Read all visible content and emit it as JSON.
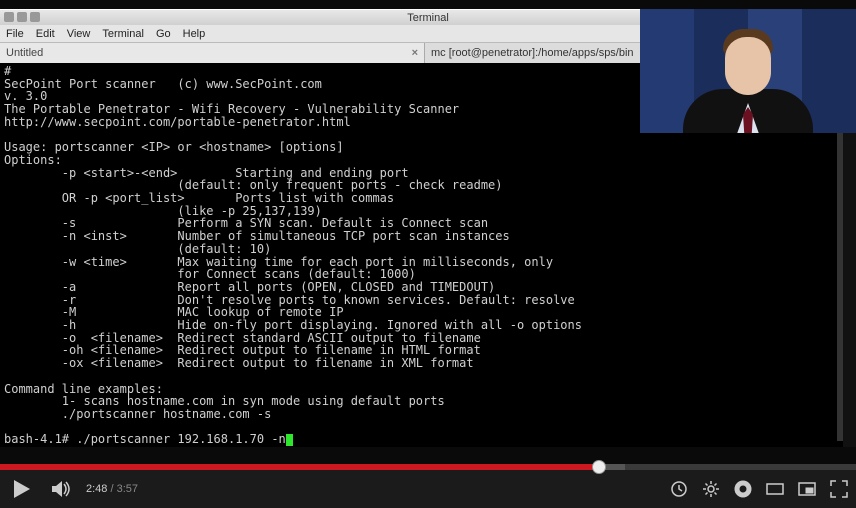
{
  "window": {
    "title": "Terminal"
  },
  "menu": {
    "file": "File",
    "edit": "Edit",
    "view": "View",
    "terminal": "Terminal",
    "go": "Go",
    "help": "Help"
  },
  "tabs": {
    "tab1": "Untitled",
    "tab2": "mc [root@penetrator]:/home/apps/sps/bin"
  },
  "terminal": {
    "body": "#\nSecPoint Port scanner   (c) www.SecPoint.com\nv. 3.0\nThe Portable Penetrator - Wifi Recovery - Vulnerability Scanner\nhttp://www.secpoint.com/portable-penetrator.html\n\nUsage: portscanner <IP> or <hostname> [options]\nOptions:\n        -p <start>-<end>        Starting and ending port\n                        (default: only frequent ports - check readme)\n        OR -p <port_list>       Ports list with commas\n                        (like -p 25,137,139)\n        -s              Perform a SYN scan. Default is Connect scan\n        -n <inst>       Number of simultaneous TCP port scan instances\n                        (default: 10)\n        -w <time>       Max waiting time for each port in milliseconds, only\n                        for Connect scans (default: 1000)\n        -a              Report all ports (OPEN, CLOSED and TIMEDOUT)\n        -r              Don't resolve ports to known services. Default: resolve\n        -M              MAC lookup of remote IP\n        -h              Hide on-fly port displaying. Ignored with all -o options\n        -o  <filename>  Redirect standard ASCII output to filename\n        -oh <filename>  Redirect output to filename in HTML format\n        -ox <filename>  Redirect output to filename in XML format\n\nCommand line examples:\n        1- scans hostname.com in syn mode using default ports\n        ./portscanner hostname.com -s\n",
    "prompt": "bash-4.1# ",
    "command": "./portscanner 192.168.1.70 -n"
  },
  "player": {
    "current": "2:48",
    "sep": " / ",
    "duration": "3:57"
  }
}
